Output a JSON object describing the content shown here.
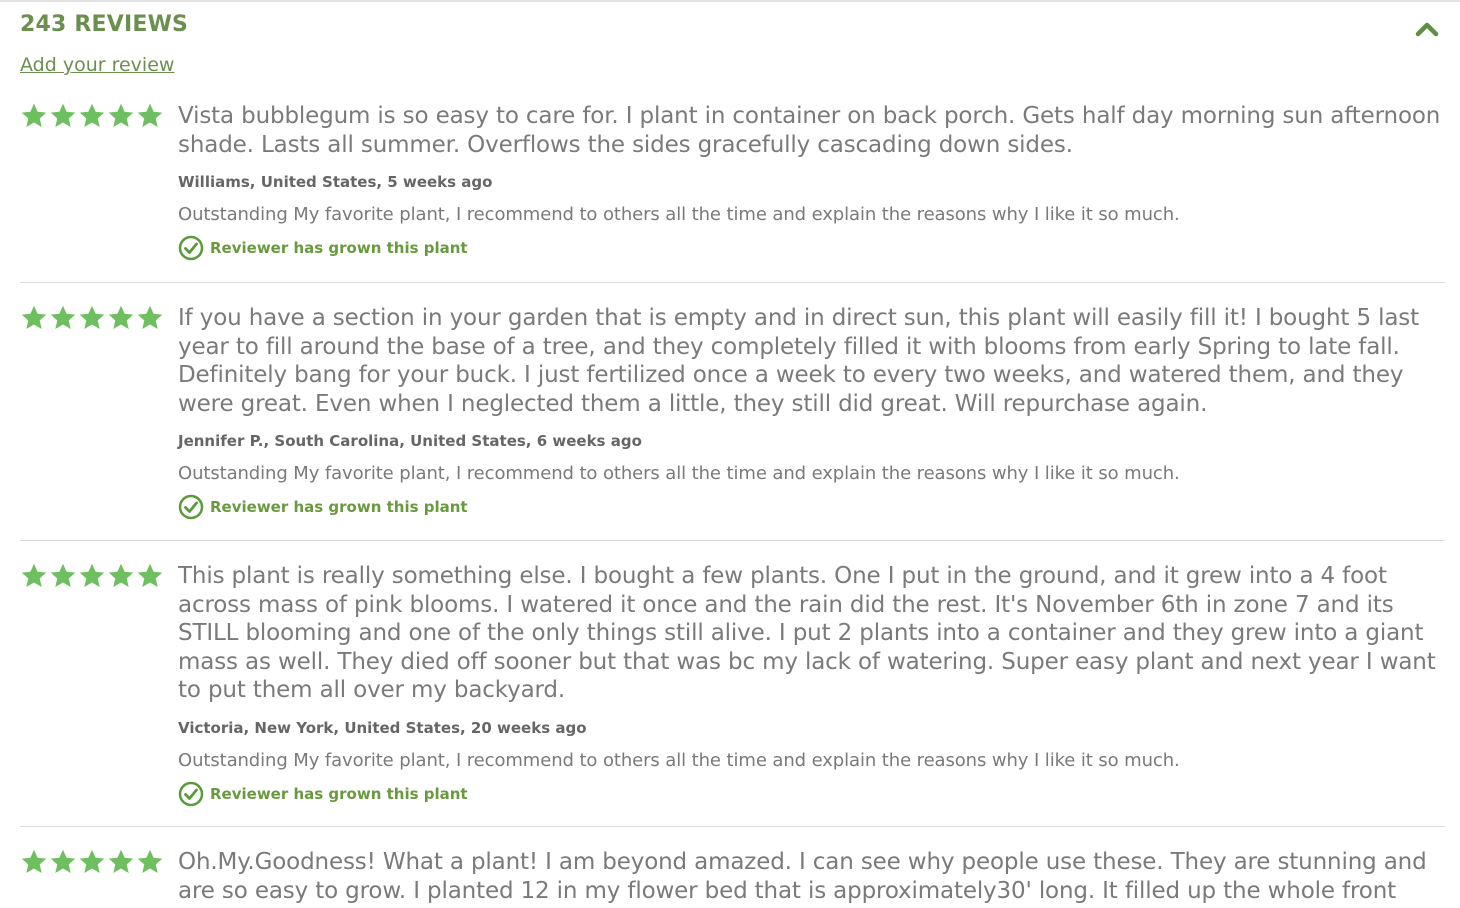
{
  "header": {
    "title": "243 REVIEWS",
    "add_review": "Add your review"
  },
  "colors": {
    "accent": "#6a8f4f",
    "star": "#6dbf5f",
    "check": "#5a9a3a"
  },
  "icons": {
    "collapse": "chevron-up-icon",
    "star": "star-icon",
    "verified": "check-circle-icon"
  },
  "reviews": [
    {
      "rating": 5,
      "text": "Vista bubblegum is so easy to care for. I plant in container on back porch. Gets half day morning sun afternoon shade. Lasts all summer. Overflows the sides gracefully cascading down sides.",
      "reviewer": "Williams, United States, 5 weeks ago",
      "rating_note": "Outstanding My favorite plant, I recommend to others all the time and explain the reasons why I like it so much.",
      "grown": "Reviewer has grown this plant"
    },
    {
      "rating": 5,
      "text": "If you have a section in your garden that is empty and in direct sun, this plant will easily fill it! I bought 5 last year to fill around the base of a tree, and they completely filled it with blooms from early Spring to late fall. Definitely bang for your buck. I just fertilized once a week to every two weeks, and watered them, and they were great. Even when I neglected them a little, they still did great. Will repurchase again.",
      "reviewer": "Jennifer P., South Carolina, United States, 6 weeks ago",
      "rating_note": "Outstanding My favorite plant, I recommend to others all the time and explain the reasons why I like it so much.",
      "grown": "Reviewer has grown this plant"
    },
    {
      "rating": 5,
      "text": "This plant is really something else. I bought a few plants. One I put in the ground, and it grew into a 4 foot across mass of pink blooms. I watered it once and the rain did the rest. It's November 6th in zone 7 and its STILL blooming and one of the only things still alive. I put 2 plants into a container and they grew into a giant mass as well. They died off sooner but that was bc my lack of watering. Super easy plant and next year I want to put them all over my backyard.",
      "reviewer": "Victoria, New York, United States, 20 weeks ago",
      "rating_note": "Outstanding My favorite plant, I recommend to others all the time and explain the reasons why I like it so much.",
      "grown": "Reviewer has grown this plant"
    },
    {
      "rating": 5,
      "text": "Oh.My.Goodness! What a plant! I am beyond amazed. I can see why people use these. They are stunning and are so easy to grow. I planted 12 in my flower bed that is approximately30' long. It filled up the whole front area and"
    }
  ]
}
